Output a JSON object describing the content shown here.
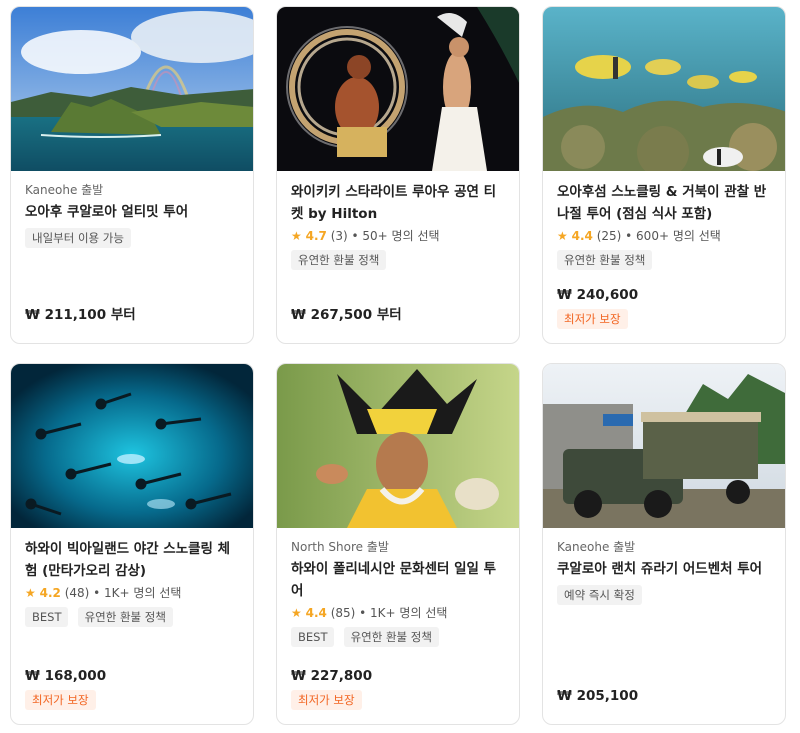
{
  "currency_symbol": "₩",
  "cards": [
    {
      "departure": "Kaneohe 출발",
      "title": "오아후 쿠알로아 얼티밋 투어",
      "tags": [
        "내일부터 이용 가능"
      ],
      "price": "211,100",
      "price_suffix": "부터",
      "image": "kualoa-aerial-rainbow"
    },
    {
      "title": "와이키키 스타라이트 루아우 공연 티켓 by Hilton",
      "rating": "4.7",
      "reviews": "(3)",
      "bookings": "• 50+ 명의 선택",
      "tags": [
        "유연한 환불 정책"
      ],
      "price": "267,500",
      "price_suffix": "부터",
      "image": "fire-dancer"
    },
    {
      "title": "오아후섬 스노클링 & 거북이 관찰 반나절 투어 (점심 식사 포함)",
      "rating": "4.4",
      "reviews": "(25)",
      "bookings": "• 600+ 명의 선택",
      "tags": [
        "유연한 환불 정책"
      ],
      "price": "240,600",
      "promo": "최저가 보장",
      "image": "reef-fish"
    },
    {
      "title": "하와이 빅아일랜드 야간 스노클링 체험 (만타가오리 감상)",
      "rating": "4.2",
      "reviews": "(48)",
      "bookings": "• 1K+ 명의 선택",
      "tags": [
        "BEST",
        "유연한 환불 정책"
      ],
      "price": "168,000",
      "promo": "최저가 보장",
      "image": "night-snorkel"
    },
    {
      "departure": "North Shore 출발",
      "title": "하와이 폴리네시안 문화센터 일일 투어",
      "rating": "4.4",
      "reviews": "(85)",
      "bookings": "• 1K+ 명의 선택",
      "tags": [
        "BEST",
        "유연한 환불 정책"
      ],
      "price": "227,800",
      "promo": "최저가 보장",
      "image": "polynesian-dancer"
    },
    {
      "departure": "Kaneohe 출발",
      "title": "쿠알로아 랜치 쥬라기 어드벤처 투어",
      "tags": [
        "예약 즉시 확정"
      ],
      "price": "205,100",
      "image": "kualoa-safari-truck"
    }
  ],
  "colors": {
    "star": "#f5a623",
    "promo_text": "#f26522",
    "promo_bg": "#fff0e8",
    "tag_bg": "#f2f2f2"
  }
}
